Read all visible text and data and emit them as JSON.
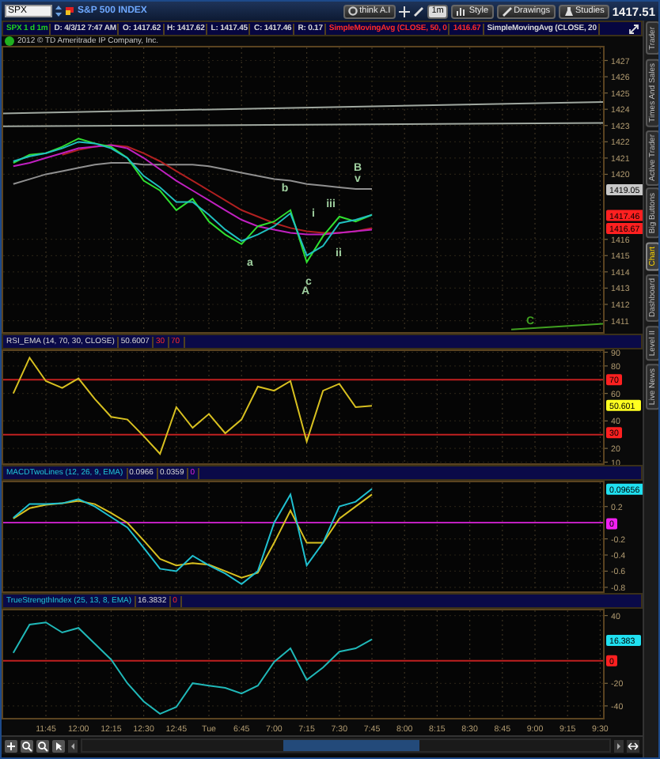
{
  "toolbar": {
    "symbol": "SPX",
    "description": "S&P 500 INDEX",
    "layout_button": "think A.I",
    "buttons": [
      {
        "label": "1m",
        "kind": "period"
      },
      {
        "label": "Style",
        "kind": "menu"
      },
      {
        "label": "Drawings",
        "kind": "menu"
      },
      {
        "label": "Studies",
        "kind": "menu"
      }
    ],
    "last_price": "1417.51"
  },
  "info_bar": [
    {
      "text": "SPX 1 d 1m",
      "kind": "symbol"
    },
    {
      "text": "D: 4/3/12 7:47 AM",
      "kind": "quote"
    },
    {
      "text": "O: 1417.62",
      "kind": "quote"
    },
    {
      "text": "H: 1417.62",
      "kind": "quote"
    },
    {
      "text": "L: 1417.45",
      "kind": "quote"
    },
    {
      "text": "C: 1417.46",
      "kind": "quote"
    },
    {
      "text": "R: 0.17",
      "kind": "quote"
    },
    {
      "text": "SimpleMovingAvg (CLOSE, 50, 0",
      "kind": "alert"
    },
    {
      "text": "1416.67",
      "kind": "alert"
    },
    {
      "text": "SimpleMovingAvg (CLOSE, 20",
      "kind": "quote"
    }
  ],
  "copyright": "2012 © TD Ameritrade IP Company, Inc.",
  "panels": [
    {
      "marks": [
        {
          "kind": "trendline",
          "color": "#a0a8a0"
        },
        {
          "kind": "trendline",
          "color": "#a0a8a0"
        },
        {
          "kind": "trendline",
          "color": "#40a020"
        },
        {
          "kind": "label",
          "text": "B",
          "color": "#a0d0a0"
        },
        {
          "kind": "label",
          "text": "v",
          "color": "#a0d0a0"
        },
        {
          "kind": "label",
          "text": "b",
          "color": "#a0d0a0"
        },
        {
          "kind": "label",
          "text": "iii",
          "color": "#a0d0a0"
        },
        {
          "kind": "label",
          "text": "i",
          "color": "#a0d0a0"
        },
        {
          "kind": "label",
          "text": "ii",
          "color": "#a0d0a0"
        },
        {
          "kind": "label",
          "text": "a",
          "color": "#a0d0a0"
        },
        {
          "kind": "label",
          "text": "c",
          "color": "#a0d0a0"
        },
        {
          "kind": "label",
          "text": "A",
          "color": "#a0d0a0"
        },
        {
          "kind": "label",
          "text": "C",
          "color": "#40a020"
        }
      ],
      "price_tags": [
        {
          "text": "1419.05",
          "color": "#c8c8c8"
        },
        {
          "text": "1417.46",
          "color": "#ff2020"
        },
        {
          "text": "1416.67",
          "color": "#ff2020"
        }
      ],
      "chart_data": {
        "type": "line",
        "grid": true,
        "categories": [
          null,
          null,
          null,
          null,
          null,
          null,
          null,
          null,
          null,
          null,
          null,
          null,
          null,
          null,
          null,
          null,
          null,
          null,
          null,
          null,
          null,
          null,
          null,
          null,
          null,
          null,
          null,
          null,
          null,
          null,
          null,
          null,
          null,
          null,
          null,
          null,
          null
        ],
        "ylim": [
          1410.2,
          1427.9
        ],
        "yticks": [
          1411,
          1412,
          1413,
          1414,
          1415,
          1416,
          1420,
          1421,
          1422,
          1423,
          1424,
          1425,
          1426,
          1427
        ],
        "series": [
          {
            "color": "#909090",
            "values": [
              1419.4,
              1419.7,
              1420.0,
              1420.2,
              1420.4,
              1420.6,
              1420.7,
              1420.7,
              1420.6,
              1420.6,
              1420.6,
              1420.6,
              1420.5,
              1420.3,
              1420.1,
              1419.9,
              1419.7,
              1419.6,
              1419.4,
              1419.3,
              1419.2,
              1419.1,
              1419.1,
              null,
              null,
              null,
              null,
              null,
              null,
              null,
              null,
              null,
              null,
              null,
              null,
              null,
              null
            ]
          },
          {
            "color": "#b02020",
            "values": [
              null,
              null,
              null,
              1421.2,
              1421.5,
              1421.7,
              1421.8,
              1421.7,
              1421.3,
              1420.8,
              1420.2,
              1419.6,
              1419.0,
              1418.4,
              1417.8,
              1417.4,
              1417.0,
              1416.7,
              1416.5,
              1416.4,
              1416.4,
              1416.5,
              1416.7,
              null,
              null,
              null,
              null,
              null,
              null,
              null,
              null,
              null,
              null,
              null,
              null,
              null,
              null
            ]
          },
          {
            "color": "#c020c0",
            "values": [
              1420.5,
              1420.7,
              1421.0,
              1421.3,
              1421.6,
              1421.7,
              1421.8,
              1421.6,
              1421.0,
              1420.3,
              1419.6,
              1419.0,
              1418.4,
              1417.8,
              1417.2,
              1416.8,
              1416.6,
              1416.4,
              1416.3,
              1416.3,
              1416.4,
              1416.5,
              1416.6,
              null,
              null,
              null,
              null,
              null,
              null,
              null,
              null,
              null,
              null,
              null,
              null,
              null,
              null
            ]
          },
          {
            "color": "#30e030",
            "values": [
              1420.7,
              1421.2,
              1421.3,
              1421.7,
              1422.2,
              1421.9,
              1421.7,
              1421.0,
              1419.6,
              1419.0,
              1417.8,
              1418.5,
              1417.1,
              1416.3,
              1415.7,
              1416.8,
              1417.1,
              1417.8,
              1414.6,
              1416.2,
              1417.4,
              1417.1,
              1417.5,
              null,
              null,
              null,
              null,
              null,
              null,
              null,
              null,
              null,
              null,
              null,
              null,
              null,
              null
            ]
          },
          {
            "color": "#20c0c0",
            "values": [
              1420.8,
              1421.1,
              1421.3,
              1421.6,
              1422.0,
              1421.9,
              1421.6,
              1421.0,
              1419.9,
              1419.2,
              1418.3,
              1418.3,
              1417.5,
              1416.6,
              1415.9,
              1416.3,
              1416.8,
              1417.6,
              1415.0,
              1415.6,
              1417.0,
              1417.2,
              1417.5,
              null,
              null,
              null,
              null,
              null,
              null,
              null,
              null,
              null,
              null,
              null,
              null,
              null,
              null
            ]
          }
        ]
      }
    },
    {
      "legend": [
        {
          "text": "RSI_EMA (14, 70, 30, CLOSE)",
          "kind": "plain"
        },
        {
          "text": "50.6007",
          "kind": "plain"
        },
        {
          "text": "30",
          "kind": "alert"
        },
        {
          "text": "70",
          "kind": "alert"
        }
      ],
      "price_tags": [
        {
          "text": "70",
          "color": "#ff2020"
        },
        {
          "text": "50.601",
          "color": "#ffff20"
        },
        {
          "text": "30",
          "color": "#ff2020"
        }
      ],
      "chart_data": {
        "type": "line",
        "grid": true,
        "categories": [
          null,
          null,
          null,
          null,
          null,
          null,
          null,
          null,
          null,
          null,
          null,
          null,
          null,
          null,
          null,
          null,
          null,
          null,
          null,
          null,
          null,
          null,
          null,
          null,
          null,
          null,
          null,
          null,
          null,
          null,
          null,
          null,
          null,
          null,
          null,
          null,
          null
        ],
        "ylim": [
          8,
          92
        ],
        "yticks": [
          10,
          20,
          40,
          60,
          80,
          90
        ],
        "ref_lines": [
          {
            "axis": "y",
            "value": 70,
            "color": "#c02020"
          },
          {
            "axis": "y",
            "value": 30,
            "color": "#c02020"
          }
        ],
        "series": [
          {
            "color": "#d8c020",
            "values": [
              60,
              86,
              69,
              64,
              71,
              56,
              43,
              41,
              29,
              16,
              50,
              35,
              45,
              31,
              41,
              65,
              62,
              69,
              25,
              62,
              67,
              50,
              51,
              null,
              null,
              null,
              null,
              null,
              null,
              null,
              null,
              null,
              null,
              null,
              null,
              null,
              null
            ]
          }
        ]
      }
    },
    {
      "legend": [
        {
          "text": "MACDTwoLines (12, 26, 9, EMA)",
          "kind": "study"
        },
        {
          "text": "0.0966",
          "kind": "plain"
        },
        {
          "text": "0.0359",
          "kind": "plain"
        },
        {
          "text": "0",
          "kind": "zero"
        }
      ],
      "price_tags": [
        {
          "text": "0.09656",
          "color": "#20e0f0"
        },
        {
          "text": "0",
          "color": "#f020f0"
        }
      ],
      "chart_data": {
        "type": "line",
        "grid": true,
        "categories": [
          null,
          null,
          null,
          null,
          null,
          null,
          null,
          null,
          null,
          null,
          null,
          null,
          null,
          null,
          null,
          null,
          null,
          null,
          null,
          null,
          null,
          null,
          null,
          null,
          null,
          null,
          null,
          null,
          null,
          null,
          null,
          null,
          null,
          null,
          null,
          null,
          null
        ],
        "ylim": [
          -0.87,
          0.52
        ],
        "yticks": [
          0.2,
          -0.2,
          -0.4,
          -0.6,
          -0.8
        ],
        "ref_lines": [
          {
            "axis": "y",
            "value": 0,
            "color": "#c020c0"
          }
        ],
        "series": [
          {
            "color": "#d8c020",
            "values": [
              0.05,
              0.18,
              0.22,
              0.24,
              0.27,
              0.23,
              0.12,
              0.0,
              -0.22,
              -0.45,
              -0.53,
              -0.5,
              -0.52,
              -0.6,
              -0.68,
              -0.62,
              -0.25,
              0.15,
              -0.25,
              -0.25,
              0.05,
              0.2,
              0.35,
              null,
              null,
              null,
              null,
              null,
              null,
              null,
              null,
              null,
              null,
              null,
              null,
              null,
              null
            ]
          },
          {
            "color": "#20c0d0",
            "values": [
              0.06,
              0.23,
              0.23,
              0.24,
              0.29,
              0.2,
              0.07,
              -0.06,
              -0.31,
              -0.57,
              -0.6,
              -0.41,
              -0.53,
              -0.63,
              -0.76,
              -0.6,
              0.0,
              0.35,
              -0.53,
              -0.25,
              0.2,
              0.26,
              0.42,
              null,
              null,
              null,
              null,
              null,
              null,
              null,
              null,
              null,
              null,
              null,
              null,
              null,
              null
            ]
          }
        ]
      }
    },
    {
      "legend": [
        {
          "text": "TrueStrengthIndex (25, 13, 8, EMA)",
          "kind": "study"
        },
        {
          "text": "16.3832",
          "kind": "plain"
        },
        {
          "text": "0",
          "kind": "alert"
        }
      ],
      "price_tags": [
        {
          "text": "16.383",
          "color": "#20e0f0"
        },
        {
          "text": "0",
          "color": "#ff2020"
        }
      ],
      "chart_data": {
        "type": "line",
        "grid": true,
        "categories": [
          null,
          null,
          "11:45",
          null,
          "12:00",
          null,
          "12:15",
          null,
          "12:30",
          null,
          "12:45",
          null,
          "Tue",
          null,
          "6:45",
          null,
          "7:00",
          null,
          "7:15",
          null,
          "7:30",
          null,
          "7:45",
          null,
          "8:00",
          null,
          "8:15",
          null,
          "8:30",
          null,
          "8:45",
          null,
          "9:00",
          null,
          "9:15",
          null,
          "9:30"
        ],
        "ylim": [
          -52,
          46
        ],
        "yticks": [
          40,
          -20,
          -40
        ],
        "ref_lines": [
          {
            "axis": "y",
            "value": 0,
            "color": "#c02020"
          }
        ],
        "series": [
          {
            "color": "#20b8b8",
            "values": [
              7,
              32,
              34,
              25,
              29,
              15,
              1,
              -20,
              -36,
              -47,
              -41,
              -20,
              -22,
              -24,
              -29,
              -22,
              -1,
              11,
              -17,
              -6,
              8,
              11,
              19,
              null,
              null,
              null,
              null,
              null,
              null,
              null,
              null,
              null,
              null,
              null,
              null,
              null,
              null
            ]
          }
        ]
      }
    }
  ],
  "side_tabs": [
    {
      "label": "Trader",
      "selected": false
    },
    {
      "label": "Times And Sales",
      "selected": false
    },
    {
      "label": "Active Trader",
      "selected": false
    },
    {
      "label": "Big Buttons",
      "selected": false
    },
    {
      "label": "Chart",
      "selected": true
    },
    {
      "label": "Dashboard",
      "selected": false
    },
    {
      "label": "Level II",
      "selected": false
    },
    {
      "label": "Live News",
      "selected": false
    }
  ]
}
